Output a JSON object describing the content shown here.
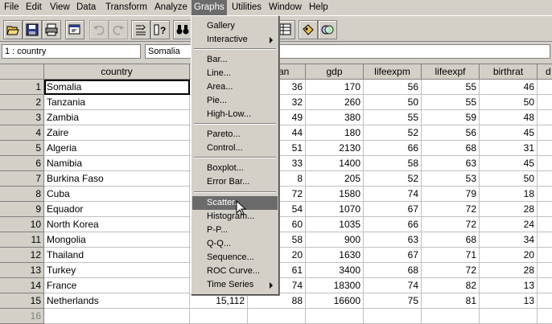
{
  "menubar": {
    "items": [
      "File",
      "Edit",
      "View",
      "Data",
      "Transform",
      "Analyze",
      "Graphs",
      "Utilities",
      "Window",
      "Help"
    ]
  },
  "cellbar": {
    "ref": "1 : country",
    "value": "Somalia"
  },
  "columns": [
    "country",
    "",
    "gdp",
    "lifeexpm",
    "lifeexpf",
    "birthrat",
    "d"
  ],
  "hidden_col_header_fragment": "an",
  "rows": [
    {
      "n": "1",
      "country": "Somalia",
      "pop": "",
      "urban": "36",
      "gdp": "170",
      "m": "56",
      "f": "55",
      "b": "46"
    },
    {
      "n": "2",
      "country": "Tanzania",
      "pop": "",
      "urban": "32",
      "gdp": "260",
      "m": "50",
      "f": "55",
      "b": "50"
    },
    {
      "n": "3",
      "country": "Zambia",
      "pop": "",
      "urban": "49",
      "gdp": "380",
      "m": "55",
      "f": "59",
      "b": "48"
    },
    {
      "n": "4",
      "country": "Zaire",
      "pop": "",
      "urban": "44",
      "gdp": "180",
      "m": "52",
      "f": "56",
      "b": "45"
    },
    {
      "n": "5",
      "country": "Algeria",
      "pop": "",
      "urban": "51",
      "gdp": "2130",
      "m": "66",
      "f": "68",
      "b": "31"
    },
    {
      "n": "6",
      "country": "Namibia",
      "pop": "",
      "urban": "33",
      "gdp": "1400",
      "m": "58",
      "f": "63",
      "b": "45"
    },
    {
      "n": "7",
      "country": "Burkina Faso",
      "pop": "",
      "urban": "8",
      "gdp": "205",
      "m": "52",
      "f": "53",
      "b": "50"
    },
    {
      "n": "8",
      "country": "Cuba",
      "pop": "",
      "urban": "72",
      "gdp": "1580",
      "m": "74",
      "f": "79",
      "b": "18"
    },
    {
      "n": "9",
      "country": "Equador",
      "pop": "",
      "urban": "54",
      "gdp": "1070",
      "m": "67",
      "f": "72",
      "b": "28"
    },
    {
      "n": "10",
      "country": "North Korea",
      "pop": "",
      "urban": "60",
      "gdp": "1035",
      "m": "66",
      "f": "72",
      "b": "24"
    },
    {
      "n": "11",
      "country": "Mongolia",
      "pop": "",
      "urban": "58",
      "gdp": "900",
      "m": "63",
      "f": "68",
      "b": "34"
    },
    {
      "n": "12",
      "country": "Thailand",
      "pop": "",
      "urban": "20",
      "gdp": "1630",
      "m": "67",
      "f": "71",
      "b": "20"
    },
    {
      "n": "13",
      "country": "Turkey",
      "pop": "",
      "urban": "61",
      "gdp": "3400",
      "m": "68",
      "f": "72",
      "b": "28"
    },
    {
      "n": "14",
      "country": "France",
      "pop": "",
      "urban": "74",
      "gdp": "18300",
      "m": "74",
      "f": "82",
      "b": "13"
    },
    {
      "n": "15",
      "country": "Netherlands",
      "pop": "15,112",
      "urban": "88",
      "gdp": "16600",
      "m": "75",
      "f": "81",
      "b": "13"
    },
    {
      "n": "16",
      "country": "",
      "pop": "",
      "urban": "",
      "gdp": "",
      "m": "",
      "f": "",
      "b": ""
    }
  ],
  "graphs_menu": [
    {
      "label": "Gallery"
    },
    {
      "label": "Interactive",
      "submenu": true
    },
    {
      "label": "Bar..."
    },
    {
      "label": "Line..."
    },
    {
      "label": "Area..."
    },
    {
      "label": "Pie..."
    },
    {
      "label": "High-Low..."
    },
    {
      "label": "Pareto..."
    },
    {
      "label": "Control..."
    },
    {
      "label": "Boxplot..."
    },
    {
      "label": "Error Bar..."
    },
    {
      "label": "Scatter..."
    },
    {
      "label": "Histogram..."
    },
    {
      "label": "P-P..."
    },
    {
      "label": "Q-Q..."
    },
    {
      "label": "Sequence..."
    },
    {
      "label": "ROC Curve..."
    },
    {
      "label": "Time Series",
      "submenu": true
    }
  ]
}
